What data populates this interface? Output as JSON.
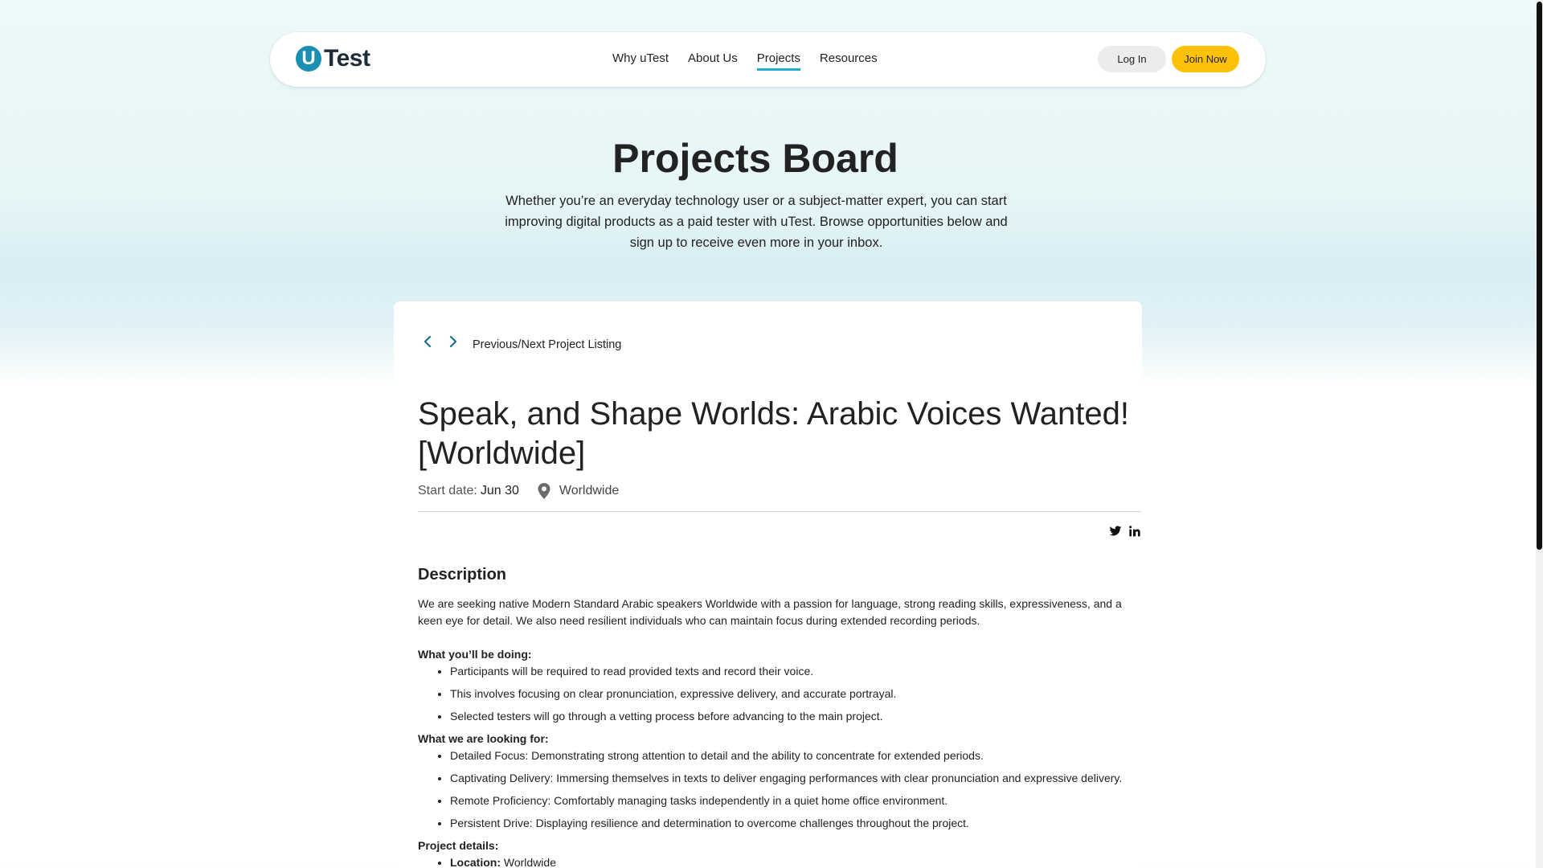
{
  "header": {
    "logo_letter": "U",
    "logo_text": "Test",
    "nav": [
      "Why uTest",
      "About Us",
      "Projects",
      "Resources"
    ],
    "login_label": "Log In",
    "join_label": "Join Now"
  },
  "hero": {
    "title": "Projects Board",
    "subtitle": "Whether you’re an everyday technology user or a subject-matter expert, you can start improving digital products as a paid tester with uTest. Browse opportunities below and sign up to receive even more in your inbox."
  },
  "listing": {
    "prev_next_label": "Previous/Next Project Listing",
    "title": "Speak, and Shape Worlds: Arabic Voices Wanted! [Worldwide]",
    "start_label": "Start date:",
    "start_value": "Jun 30",
    "location": "Worldwide",
    "description_heading": "Description",
    "intro": "We are seeking native Modern Standard Arabic speakers Worldwide with a passion for language, strong reading skills, expressiveness, and a keen eye for detail. We also need resilient individuals who can maintain focus during extended recording periods.",
    "doing_heading": "What you’ll be doing:",
    "doing_items": [
      "Participants will be required to read provided texts and record their voice.",
      "This involves focusing on clear pronunciation, expressive delivery, and accurate portrayal.",
      "Selected testers will go through a vetting process before advancing to the main project."
    ],
    "looking_heading": "What we are looking for:",
    "looking_items": [
      "Detailed Focus: Demonstrating strong attention to detail and the ability to concentrate for extended periods.",
      "Captivating Delivery: Immersing themselves in texts to deliver engaging performances with clear pronunciation and expressive delivery.",
      "Remote Proficiency: Comfortably managing tasks independently in a quiet home office environment.",
      "Persistent Drive: Displaying resilience and determination to overcome challenges throughout the project."
    ],
    "details_heading": "Project details:",
    "details_location_label": "Location:",
    "details_location_value": "Worldwide"
  },
  "colors": {
    "accent": "#1fb1c9",
    "join": "#fdc107",
    "logo": "#1a8fb0"
  }
}
